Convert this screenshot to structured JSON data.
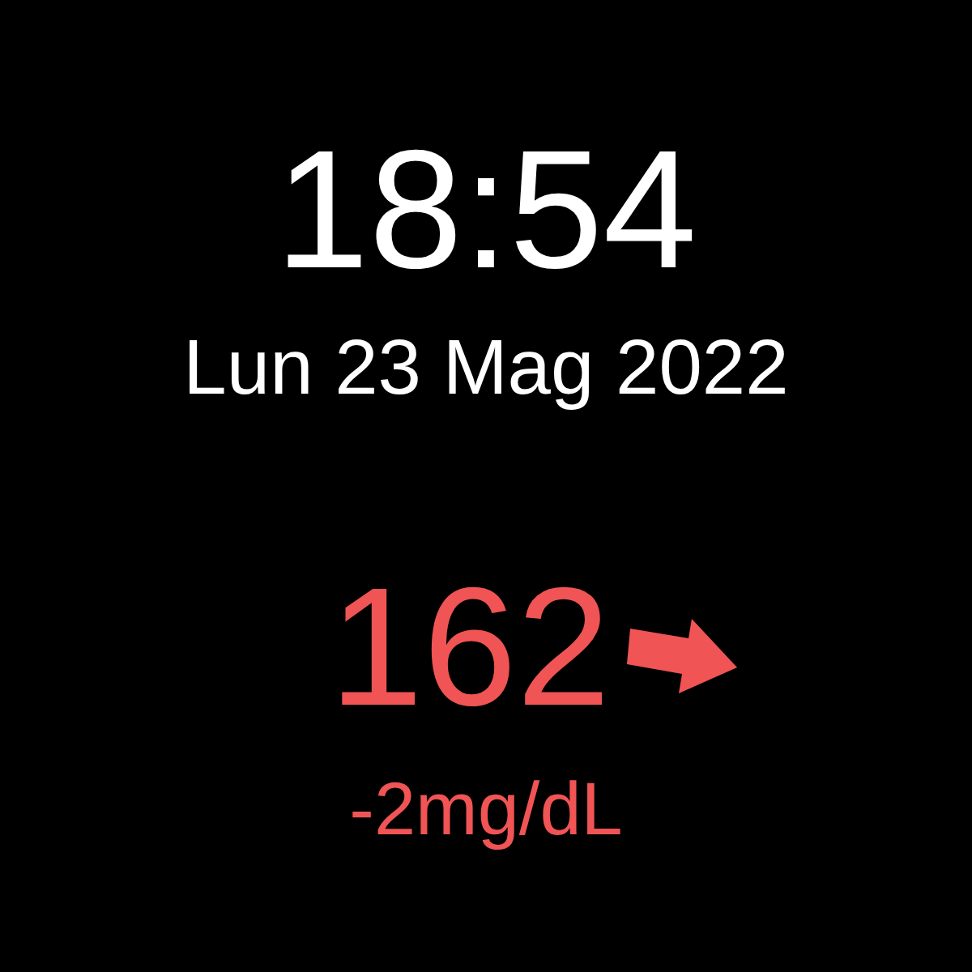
{
  "time": "18:54",
  "date": "Lun 23 Mag 2022",
  "glucose": {
    "value": "162",
    "delta": "-2mg/dL"
  }
}
